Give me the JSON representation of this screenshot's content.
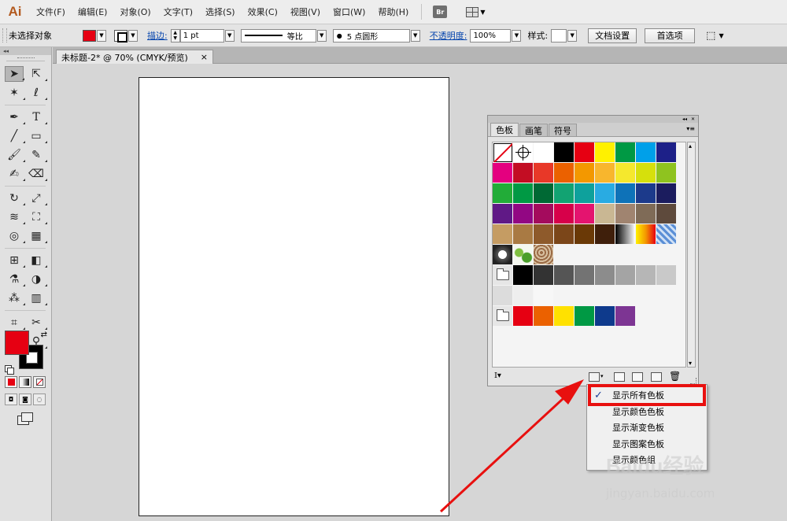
{
  "app": {
    "logo": "Ai"
  },
  "menu": [
    "文件(F)",
    "编辑(E)",
    "对象(O)",
    "文字(T)",
    "选择(S)",
    "效果(C)",
    "视图(V)",
    "窗口(W)",
    "帮助(H)"
  ],
  "menu_extra": {
    "bridge": "Br"
  },
  "control_bar": {
    "selection": "未选择对象",
    "stroke_label": "描边:",
    "stroke_weight": "1 pt",
    "stroke_profile": "等比",
    "brush": "5 点圆形",
    "opacity_label": "不透明度:",
    "opacity_value": "100%",
    "style_label": "样式:",
    "doc_setup": "文档设置",
    "preferences": "首选项"
  },
  "document_tab": {
    "title": "未标题-2* @ 70% (CMYK/预览)",
    "close": "×"
  },
  "swatches_panel": {
    "tabs": [
      "色板",
      "画笔",
      "符号"
    ],
    "active_tab": "色板",
    "rows": [
      [
        "none",
        "registration",
        "#ffffff",
        "#000000",
        "#e60012",
        "#fff100",
        "#009944",
        "#00a0e9",
        "#1d2088"
      ],
      [
        "#e4007f",
        "#c30d23",
        "#e83828",
        "#eb6100",
        "#f39800",
        "#f8b62d",
        "#f5e82d",
        "#d6e00c",
        "#8fc31f"
      ],
      [
        "#22ac38",
        "#009944",
        "#006934",
        "#12a372",
        "#0ea19c",
        "#29abe2",
        "#0e72b8",
        "#1c3a8b",
        "#1b1c5e"
      ],
      [
        "#601986",
        "#920783",
        "#a40b5d",
        "#d7004a",
        "#e4146f",
        "#c9b793",
        "#a08470",
        "#7f6b57",
        "#5e4a3c"
      ],
      [
        "#c59c63",
        "#a97a43",
        "#8e5a2b",
        "#7b4619",
        "#6a3906",
        "#3f1f0b",
        "gradient-gray",
        "gradient-warm",
        "pattern-blue"
      ],
      [
        "pattern-dots",
        "pattern-leaf",
        "pattern-swirl"
      ],
      [
        "folder",
        "#000000",
        "#333333",
        "#555555",
        "#737373",
        "#8c8c8c",
        "#a4a4a4",
        "#b6b6b6",
        "#c9c9c9"
      ],
      [
        "#dcdcdc",
        "#eeeeee",
        "#f7f7f7"
      ],
      [
        "folder",
        "#e60012",
        "#eb6100",
        "#ffe100",
        "#009944",
        "#0e3a8c",
        "#7d3593"
      ]
    ]
  },
  "dropdown_menu": {
    "items": [
      "显示所有色板",
      "显示颜色色板",
      "显示渐变色板",
      "显示图案色板",
      "显示颜色组"
    ],
    "checked": "显示所有色板",
    "check_mark": "✓"
  },
  "annotation": {
    "color": "#e8100f"
  },
  "watermark": {
    "brand": "Baidu经验",
    "url": "jingyan.baidu.com"
  },
  "tools": [
    "selection-tool",
    "direct-selection-tool",
    "magic-wand-tool",
    "lasso-tool",
    "pen-tool",
    "type-tool",
    "line-tool",
    "rectangle-tool",
    "paintbrush-tool",
    "pencil-tool",
    "blob-brush-tool",
    "eraser-tool",
    "rotate-tool",
    "scale-tool",
    "warp-tool",
    "free-transform-tool",
    "shape-builder-tool",
    "perspective-grid-tool",
    "mesh-tool",
    "gradient-tool",
    "eyedropper-tool",
    "blend-tool",
    "symbol-sprayer-tool",
    "graph-tool",
    "artboard-tool",
    "slice-tool",
    "hand-tool",
    "zoom-tool"
  ],
  "colors": {
    "fill": "#e60012",
    "stroke": "#000000"
  }
}
